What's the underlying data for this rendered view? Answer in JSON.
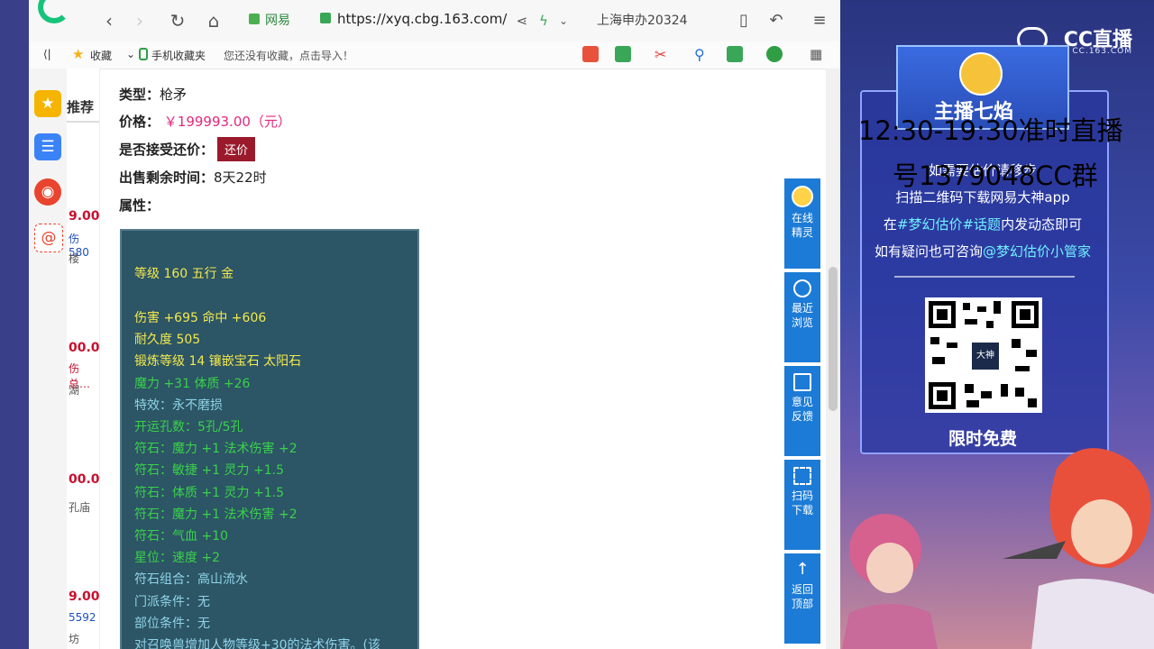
{
  "browser": {
    "site_label": "网易",
    "url": "https://xyq.cbg.163.com/",
    "search_text": "上海申办20324"
  },
  "bookmarks": {
    "items": [
      "收藏",
      "手机收藏夹",
      "您还没有收藏，点击导入！"
    ]
  },
  "listing_strip": {
    "tab": "推荐",
    "prices": [
      "9.00",
      "00.00",
      "00.00",
      "9.00"
    ],
    "subs": [
      "伤580",
      "楼",
      "伤总…",
      "湖",
      "孔庙",
      "5592",
      "坊"
    ]
  },
  "item": {
    "type_label": "类型：",
    "type_value": "枪矛",
    "price_label": "价格：",
    "price_value": "￥199993.00（元）",
    "counter_label": "是否接受还价：",
    "counter_button": "还价",
    "time_label": "出售剩余时间：",
    "time_value": "8天22时",
    "attr_label": "属性："
  },
  "attributes": [
    "等级 160 五行 金",
    "伤害 +695 命中 +606",
    "耐久度 505",
    "锻炼等级 14 镶嵌宝石 太阳石",
    "魔力 +31 体质 +26",
    "特效：永不磨损",
    "开运孔数：5孔/5孔",
    "符石：魔力 +1 法术伤害 +2",
    "符石：敏捷 +1 灵力 +1.5",
    "符石：体质 +1 灵力 +1.5",
    "符石：魔力 +1 法术伤害 +2",
    "符石：气血 +10",
    "星位：速度 +2",
    "符石组合：高山流水",
    "门派条件：无",
    "部位条件：无",
    "对召唤兽增加人物等级+30的法术伤害。(该"
  ],
  "float_panel": {
    "buttons": [
      "在线精灵",
      "最近浏览",
      "意见反馈",
      "扫码下载",
      "返回顶部"
    ]
  },
  "stream": {
    "brand": "CC直播",
    "brand_sub": "CC.163.COM",
    "anchor_name": "主播七焰",
    "schedule": "12:30-19:30准时直播",
    "group": "号1379048CC群",
    "line1": "如需要估价请移步",
    "line2": "扫描二维码下载网易大神app",
    "line3_pre": "在",
    "line3_hl": "#梦幻估价#话题",
    "line3_post": "内发动态即可",
    "line4_pre": "如有疑问也可咨询",
    "line4_hl": "@梦幻估价小管家",
    "qr_label": "大神",
    "free": "限时免费"
  }
}
